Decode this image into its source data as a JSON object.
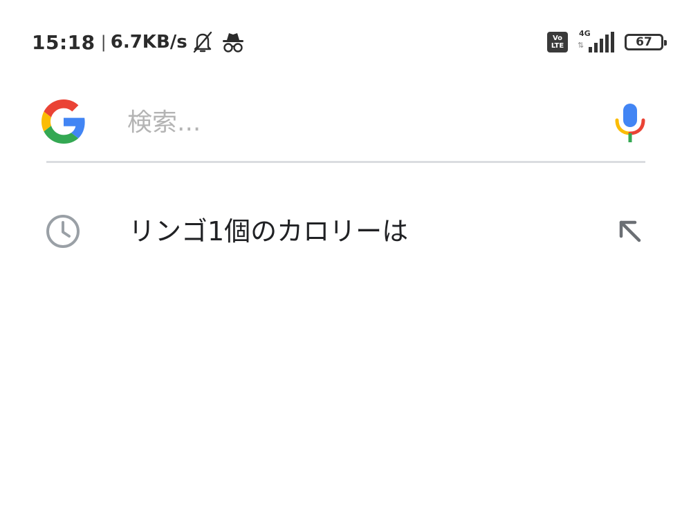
{
  "status_bar": {
    "time": "15:18",
    "separator": "|",
    "net_speed": "6.7KB/s",
    "volte_top": "Vo",
    "volte_bottom": "LTE",
    "network_type": "4G",
    "network_arrows": "⇅",
    "battery": "67"
  },
  "search": {
    "placeholder": "検索...",
    "value": ""
  },
  "suggestions": [
    {
      "text": "リンゴ1個のカロリーは",
      "icon": "history-icon",
      "action_icon": "arrow-up-left-icon"
    }
  ],
  "colors": {
    "google_blue": "#4285F4",
    "google_red": "#EA4335",
    "google_yellow": "#FBBC05",
    "google_green": "#34A853",
    "icon_gray": "#9aa0a6"
  }
}
